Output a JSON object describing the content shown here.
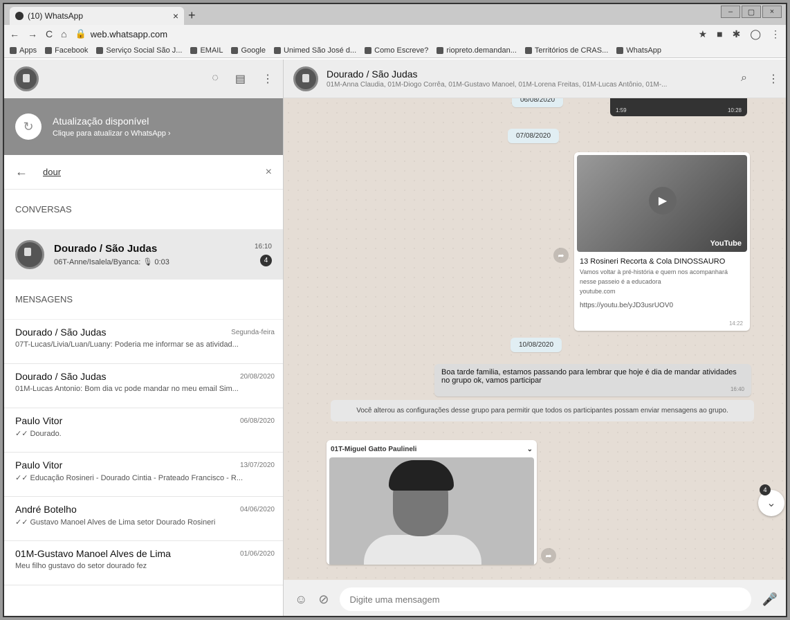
{
  "browser": {
    "tab_title": "(10) WhatsApp",
    "url": "web.whatsapp.com",
    "bookmarks": [
      "Apps",
      "Facebook",
      "Serviço Social São J...",
      "EMAIL",
      "Google",
      "Unimed São José d...",
      "Como Escreve?",
      "riopreto.demandan...",
      "Territórios de CRAS...",
      "WhatsApp"
    ]
  },
  "left": {
    "update": {
      "title": "Atualização disponível",
      "subtitle": "Clique para atualizar o WhatsApp ›"
    },
    "search": {
      "value": "dour"
    },
    "section_conversas": "CONVERSAS",
    "selected_chat": {
      "name": "Dourado / São Judas",
      "preview": "06T-Anne/Isalela/Byanca: 🎙 0:03",
      "time": "16:10",
      "unread": "4"
    },
    "section_mensagens": "MENSAGENS",
    "messages": [
      {
        "name": "Dourado / São Judas",
        "date": "Segunda-feira",
        "text": "07T-Lucas/Livia/Luan/Luany: Poderia me informar se as atividad..."
      },
      {
        "name": "Dourado / São Judas",
        "date": "20/08/2020",
        "text": "01M-Lucas Antonio: Bom dia vc pode mandar no meu email Sim..."
      },
      {
        "name": "Paulo Vitor",
        "date": "06/08/2020",
        "text": "✓✓ Dourado."
      },
      {
        "name": "Paulo Vitor",
        "date": "13/07/2020",
        "text": "✓✓ Educação Rosineri - Dourado Cintia - Prateado Francisco - R..."
      },
      {
        "name": "André Botelho",
        "date": "04/06/2020",
        "text": "✓✓ Gustavo Manoel Alves de Lima setor Dourado Rosineri"
      },
      {
        "name": "01M-Gustavo Manoel Alves de Lima",
        "date": "01/06/2020",
        "text": "Meu filho gustavo do setor dourado fez"
      }
    ]
  },
  "right": {
    "header": {
      "title": "Dourado / São Judas",
      "subtitle": "01M-Anna Claudia, 01M-Diogo Corrêa, 01M-Gustavo Manoel, 01M-Lorena Freitas, 01M-Lucas Antônio, 01M-..."
    },
    "top_date": "06/08/2020",
    "top_video": {
      "duration": "1:59",
      "time": "10:28"
    },
    "date1": "07/08/2020",
    "video_card": {
      "brand": "YouTube",
      "title": "13 Rosineri Recorta & Cola DINOSSAURO",
      "desc": "Vamos voltar à pré-história e quem nos acompanhará nesse passeio é a educadora",
      "domain": "youtube.com",
      "link": "https://youtu.be/yJD3usrUOV0",
      "time": "14:22"
    },
    "date2": "10/08/2020",
    "out_message": {
      "text": "Boa tarde familia, estamos passando para lembrar que hoje é dia de mandar atividades no grupo ok, vamos participar",
      "time": "16:40"
    },
    "notice": "Você alterou as configurações desse grupo para permitir que todos os participantes possam enviar mensagens ao grupo.",
    "photo_sender": "01T-Miguel Gatto Paulineli",
    "scroll_badge": "4",
    "composer_placeholder": "Digite uma mensagem"
  }
}
